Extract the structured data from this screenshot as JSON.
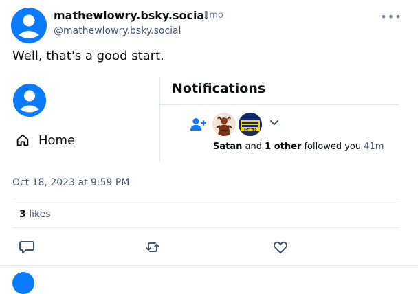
{
  "post": {
    "display_name": "mathewlowry.bsky.social",
    "separator": "·",
    "time_ago": "1mo",
    "handle": "@mathewlowry.bsky.social",
    "text": "Well, that's a good start.",
    "more_label": "•••",
    "date": "Oct 18, 2023 at 9:59 PM",
    "likes_count": "3",
    "likes_label": "likes"
  },
  "embed": {
    "nav_home_label": "Home",
    "notifications_title": "Notifications",
    "notification": {
      "actor": "Satan",
      "and": "and",
      "others": "1 other",
      "action": "followed you",
      "time": "41m"
    }
  },
  "icons": {
    "reply": "speech-bubble-icon",
    "repost": "repost-arrows-icon",
    "like": "heart-icon",
    "home": "home-icon",
    "follow": "user-plus-icon",
    "expand": "chevron-down-icon"
  },
  "colors": {
    "accent": "#0a7aff",
    "muted_text": "#42576c",
    "divider": "#e3e8ee"
  }
}
